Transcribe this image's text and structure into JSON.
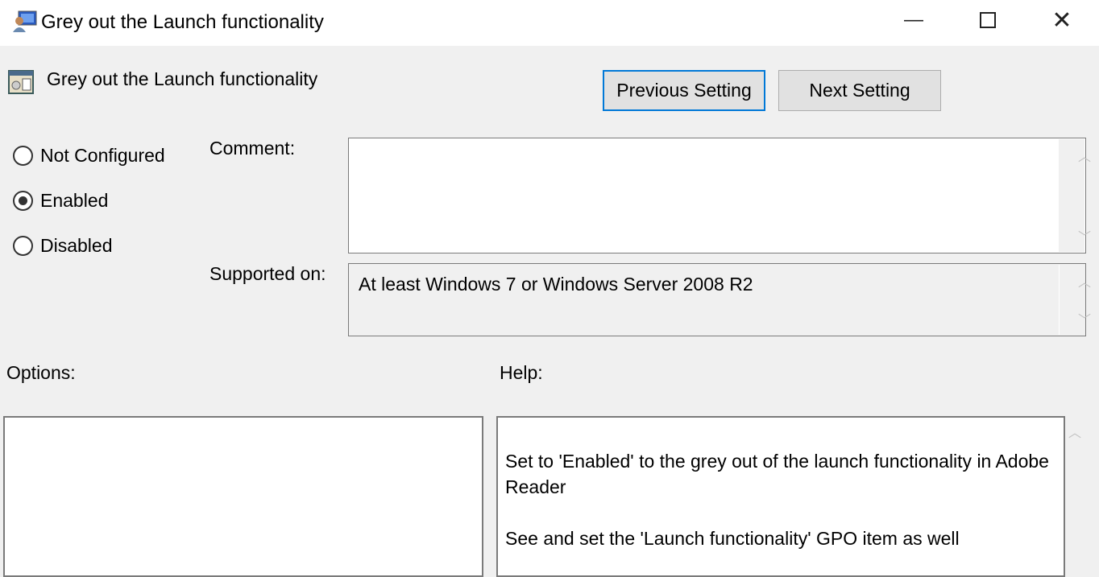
{
  "window": {
    "title": "Grey out the Launch functionality",
    "icons": {
      "app": "group-policy-computer-icon",
      "setting": "policy-setting-icon"
    }
  },
  "header": {
    "setting_name": "Grey out the Launch functionality",
    "previous_label": "Previous Setting",
    "next_label": "Next Setting"
  },
  "state": {
    "options": [
      "Not Configured",
      "Enabled",
      "Disabled"
    ],
    "selected": "Enabled"
  },
  "comment": {
    "label": "Comment:",
    "value": ""
  },
  "supported": {
    "label": "Supported on:",
    "value": "At least Windows 7 or Windows Server 2008 R2"
  },
  "options_panel": {
    "label": "Options:"
  },
  "help": {
    "label": "Help:",
    "paragraphs": [
      "Set to 'Enabled' to the grey out of the launch functionality in Adobe Reader",
      "See and set the 'Launch functionality' GPO item as well"
    ]
  },
  "colors": {
    "focus_border": "#0078d7",
    "button_bg": "#e1e1e1",
    "dialog_bg": "#f0f0f0"
  }
}
